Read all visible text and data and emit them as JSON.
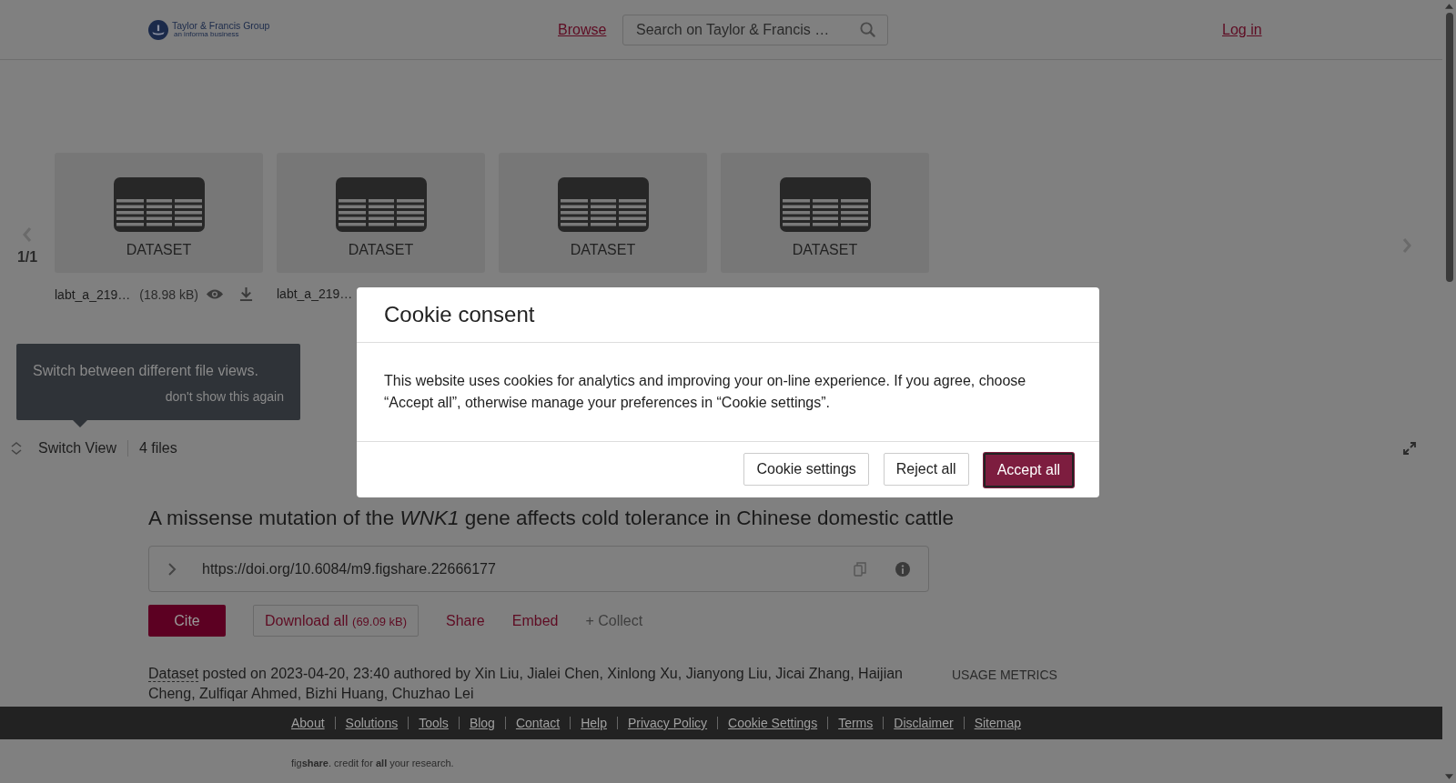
{
  "header": {
    "logo": {
      "name": "Taylor & Francis Group",
      "tagline": "an informa business"
    },
    "browse": "Browse",
    "search": {
      "placeholder": "Search on Taylor & Francis …"
    },
    "login": "Log in"
  },
  "carousel": {
    "pager": "1/1",
    "files": [
      {
        "label": "DATASET",
        "name": "labt_a_219…",
        "size": "(18.98 kB)"
      },
      {
        "label": "DATASET",
        "name": "labt_a_219…"
      },
      {
        "label": "DATASET"
      },
      {
        "label": "DATASET"
      }
    ]
  },
  "tooltip": {
    "text": "Switch between different file views.",
    "dismiss": "don't show this again"
  },
  "view_bar": {
    "switch": "Switch View",
    "count": "4 files"
  },
  "article": {
    "title": "A missense mutation of the *WNK1* gene affects cold tolerance in Chinese domestic cattle",
    "doi": "https://doi.org/10.6084/m9.figshare.22666177",
    "actions": [
      {
        "kind": "cite",
        "label": "Cite"
      },
      {
        "kind": "download",
        "label": "Download all",
        "size": "(69.09 kB)"
      },
      {
        "kind": "link",
        "label": "Share"
      },
      {
        "kind": "link",
        "label": "Embed"
      },
      {
        "kind": "muted",
        "label": "+ Collect"
      }
    ],
    "item_type": "Dataset",
    "posted": " posted on 2023-04-20, 23:40 authored by Xin Liu, Jialei Chen, Xinlong Xu, Jianyong Liu, Jicai Zhang, Haijian Cheng, Zulfiqar Ahmed, Bizhi Huang, Chuzhao Lei",
    "usage_metrics": "USAGE METRICS"
  },
  "footer": {
    "links": [
      "About",
      "Solutions",
      "Tools",
      "Blog",
      "Contact",
      "Help",
      "Privacy Policy",
      "Cookie Settings",
      "Terms",
      "Disclaimer",
      "Sitemap"
    ],
    "tagline": "fig**share**. credit for **all** your research."
  },
  "cookie": {
    "title": "Cookie consent",
    "body": "This website uses cookies for analytics and improving your on-line experience. If you agree, choose “Accept all”, otherwise manage your preferences in “Cookie settings”.",
    "buttons": [
      {
        "label": "Cookie settings",
        "kind": "secondary"
      },
      {
        "label": "Reject all",
        "kind": "secondary"
      },
      {
        "label": "Accept all",
        "kind": "primary"
      }
    ]
  }
}
